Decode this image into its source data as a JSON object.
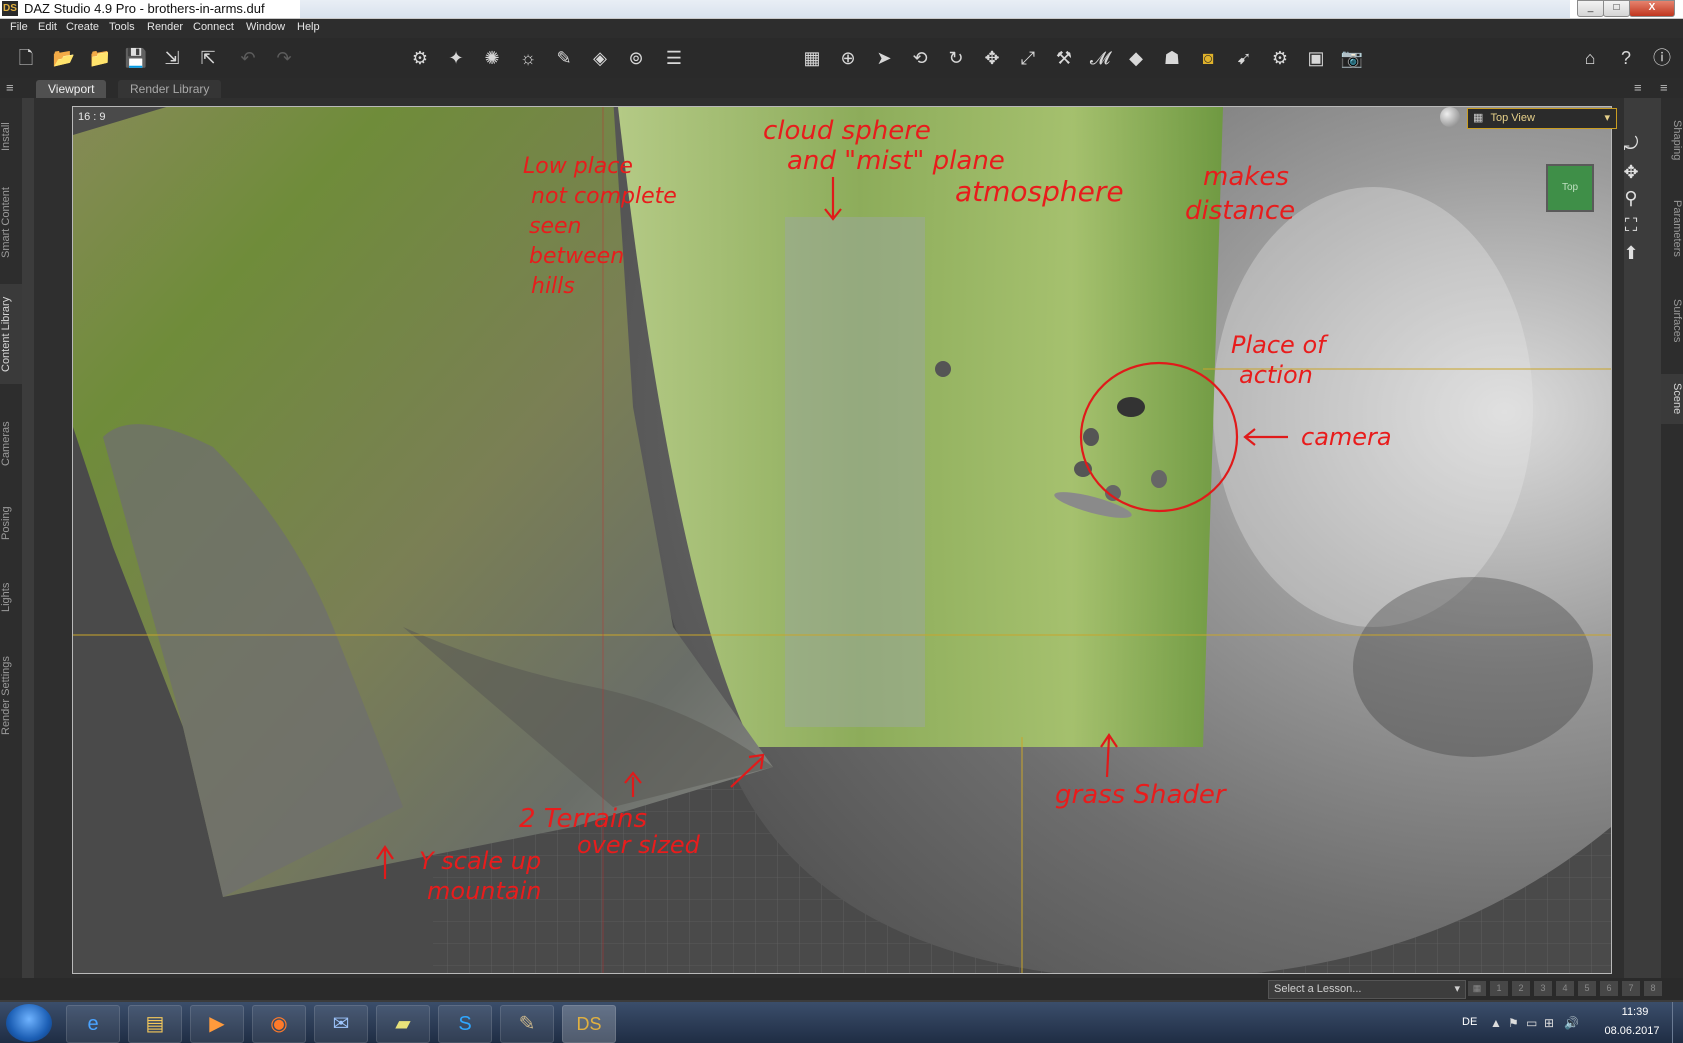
{
  "window": {
    "title": "DAZ Studio 4.9 Pro - brothers-in-arms.duf",
    "logo": "DS",
    "buttons": {
      "minimize": "_",
      "maximize": "□",
      "close": "X"
    }
  },
  "menu": [
    {
      "label": "File"
    },
    {
      "label": "Edit"
    },
    {
      "label": "Create"
    },
    {
      "label": "Tools"
    },
    {
      "label": "Render"
    },
    {
      "label": "Connect"
    },
    {
      "label": "Window"
    },
    {
      "label": "Help"
    }
  ],
  "tabs": {
    "viewport": "Viewport",
    "render_library": "Render Library"
  },
  "left_pane_tabs": [
    "Install",
    "Smart Content",
    "Content Library",
    "Cameras",
    "Posing",
    "Lights",
    "Render Settings"
  ],
  "right_pane_tabs": [
    "Shaping",
    "Parameters",
    "Surfaces",
    "Scene"
  ],
  "viewport": {
    "aspect": "16 : 9",
    "view_select": "Top View",
    "view_cube_label": "Top"
  },
  "annotations": {
    "low_place": [
      "Low place",
      "not complete",
      "seen",
      "between",
      "hills"
    ],
    "cloud_sphere": [
      "cloud sphere",
      "and \"mist\" plane"
    ],
    "atmosphere": "atmosphere",
    "makes_distance": [
      "makes",
      "distance"
    ],
    "place_of_action": [
      "Place of",
      "action"
    ],
    "camera": "camera",
    "grass_shader": "grass Shader",
    "terrains": [
      "2 Terrains",
      "over sized"
    ],
    "y_scale": [
      "Y scale up",
      "mountain"
    ]
  },
  "lesson": {
    "placeholder": "Select a Lesson...",
    "steps": [
      "1",
      "2",
      "3",
      "4",
      "5",
      "6",
      "7",
      "8"
    ]
  },
  "taskbar": {
    "apps": [
      "internet-explorer",
      "file-explorer",
      "media-player",
      "firefox",
      "thunderbird",
      "sticky-notes",
      "skype",
      "gimp",
      "daz-studio"
    ],
    "daz_label": "DS",
    "language": "DE",
    "time": "11:39",
    "date": "08.06.2017"
  }
}
